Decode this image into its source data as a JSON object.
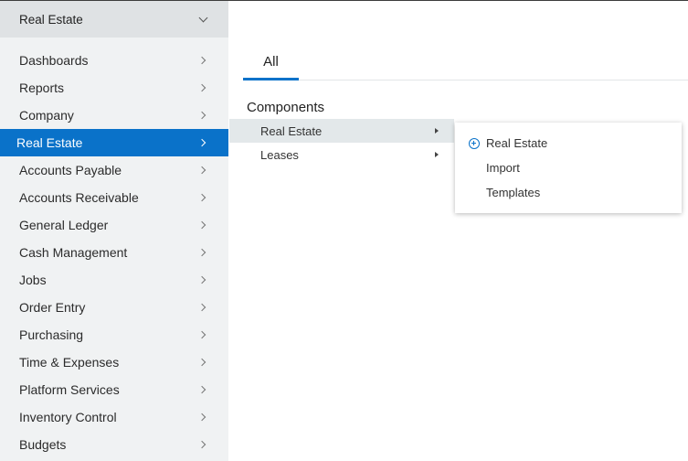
{
  "sidebar": {
    "header_label": "Real Estate",
    "items": [
      {
        "label": "Dashboards",
        "active": false
      },
      {
        "label": "Reports",
        "active": false
      },
      {
        "label": "Company",
        "active": false
      },
      {
        "label": "Real Estate",
        "active": true
      },
      {
        "label": "Accounts Payable",
        "active": false
      },
      {
        "label": "Accounts Receivable",
        "active": false
      },
      {
        "label": "General Ledger",
        "active": false
      },
      {
        "label": "Cash Management",
        "active": false
      },
      {
        "label": "Jobs",
        "active": false
      },
      {
        "label": "Order Entry",
        "active": false
      },
      {
        "label": "Purchasing",
        "active": false
      },
      {
        "label": "Time & Expenses",
        "active": false
      },
      {
        "label": "Platform Services",
        "active": false
      },
      {
        "label": "Inventory Control",
        "active": false
      },
      {
        "label": "Budgets",
        "active": false
      }
    ]
  },
  "main": {
    "tabs": [
      {
        "label": "All",
        "active": true
      }
    ],
    "components_title": "Components",
    "components": [
      {
        "label": "Real Estate",
        "hover": true
      },
      {
        "label": "Leases",
        "hover": false
      }
    ]
  },
  "flyout": {
    "items": [
      {
        "label": "Real Estate",
        "icon": "plus-circle-icon"
      },
      {
        "label": "Import"
      },
      {
        "label": "Templates"
      }
    ]
  },
  "colors": {
    "accent": "#0a72c9",
    "sidebar_bg": "#f0f2f3",
    "sidebar_header_bg": "#dfe2e4",
    "hover_bg": "#e3e8ea"
  }
}
